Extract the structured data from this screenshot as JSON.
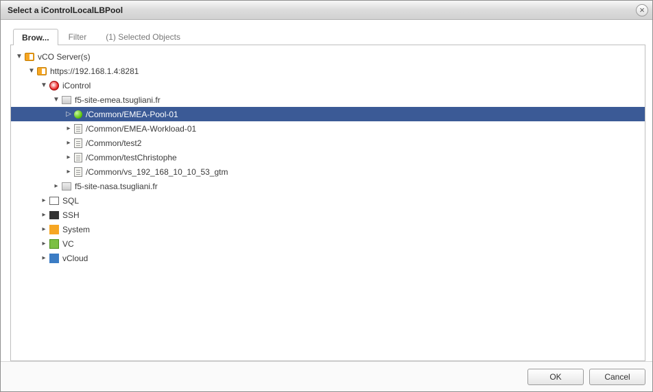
{
  "dialog": {
    "title": "Select a iControlLocalLBPool"
  },
  "tabs": {
    "browse": "Brow...",
    "filter": "Filter",
    "selected": "(1) Selected Objects"
  },
  "tree": {
    "root": "vCO Server(s)",
    "serverUrl": "https://192.168.1.4:8281",
    "icontrol": "iControl",
    "siteEmea": "f5-site-emea.tsugliani.fr",
    "pool01": "/Common/EMEA-Pool-01",
    "workload01": "/Common/EMEA-Workload-01",
    "test2": "/Common/test2",
    "testChr": "/Common/testChristophe",
    "vsgtm": "/Common/vs_192_168_10_10_53_gtm",
    "siteNasa": "f5-site-nasa.tsugliani.fr",
    "sql": "SQL",
    "ssh": "SSH",
    "system": "System",
    "vc": "VC",
    "vcloud": "vCloud"
  },
  "buttons": {
    "ok": "OK",
    "cancel": "Cancel"
  }
}
